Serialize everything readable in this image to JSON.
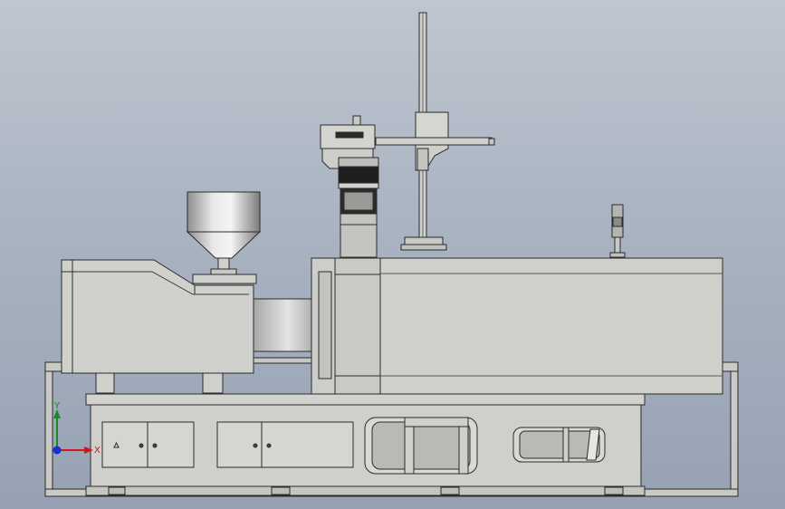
{
  "viewport": {
    "background_top": "#bfc6d0",
    "background_bottom": "#96a2b3"
  },
  "model": {
    "body_color": "#cfcfcb",
    "body_dark": "#9c9c98",
    "edge_color": "#2b2b2b",
    "steel_color": "#bdbdbd"
  },
  "triad": {
    "x_label": "X",
    "y_label": "Y",
    "x_color": "#d01818",
    "y_color": "#1a8c1a",
    "z_color": "#1a2fd0"
  },
  "cabinet": {
    "warning_icon": "warning-triangle-icon"
  }
}
